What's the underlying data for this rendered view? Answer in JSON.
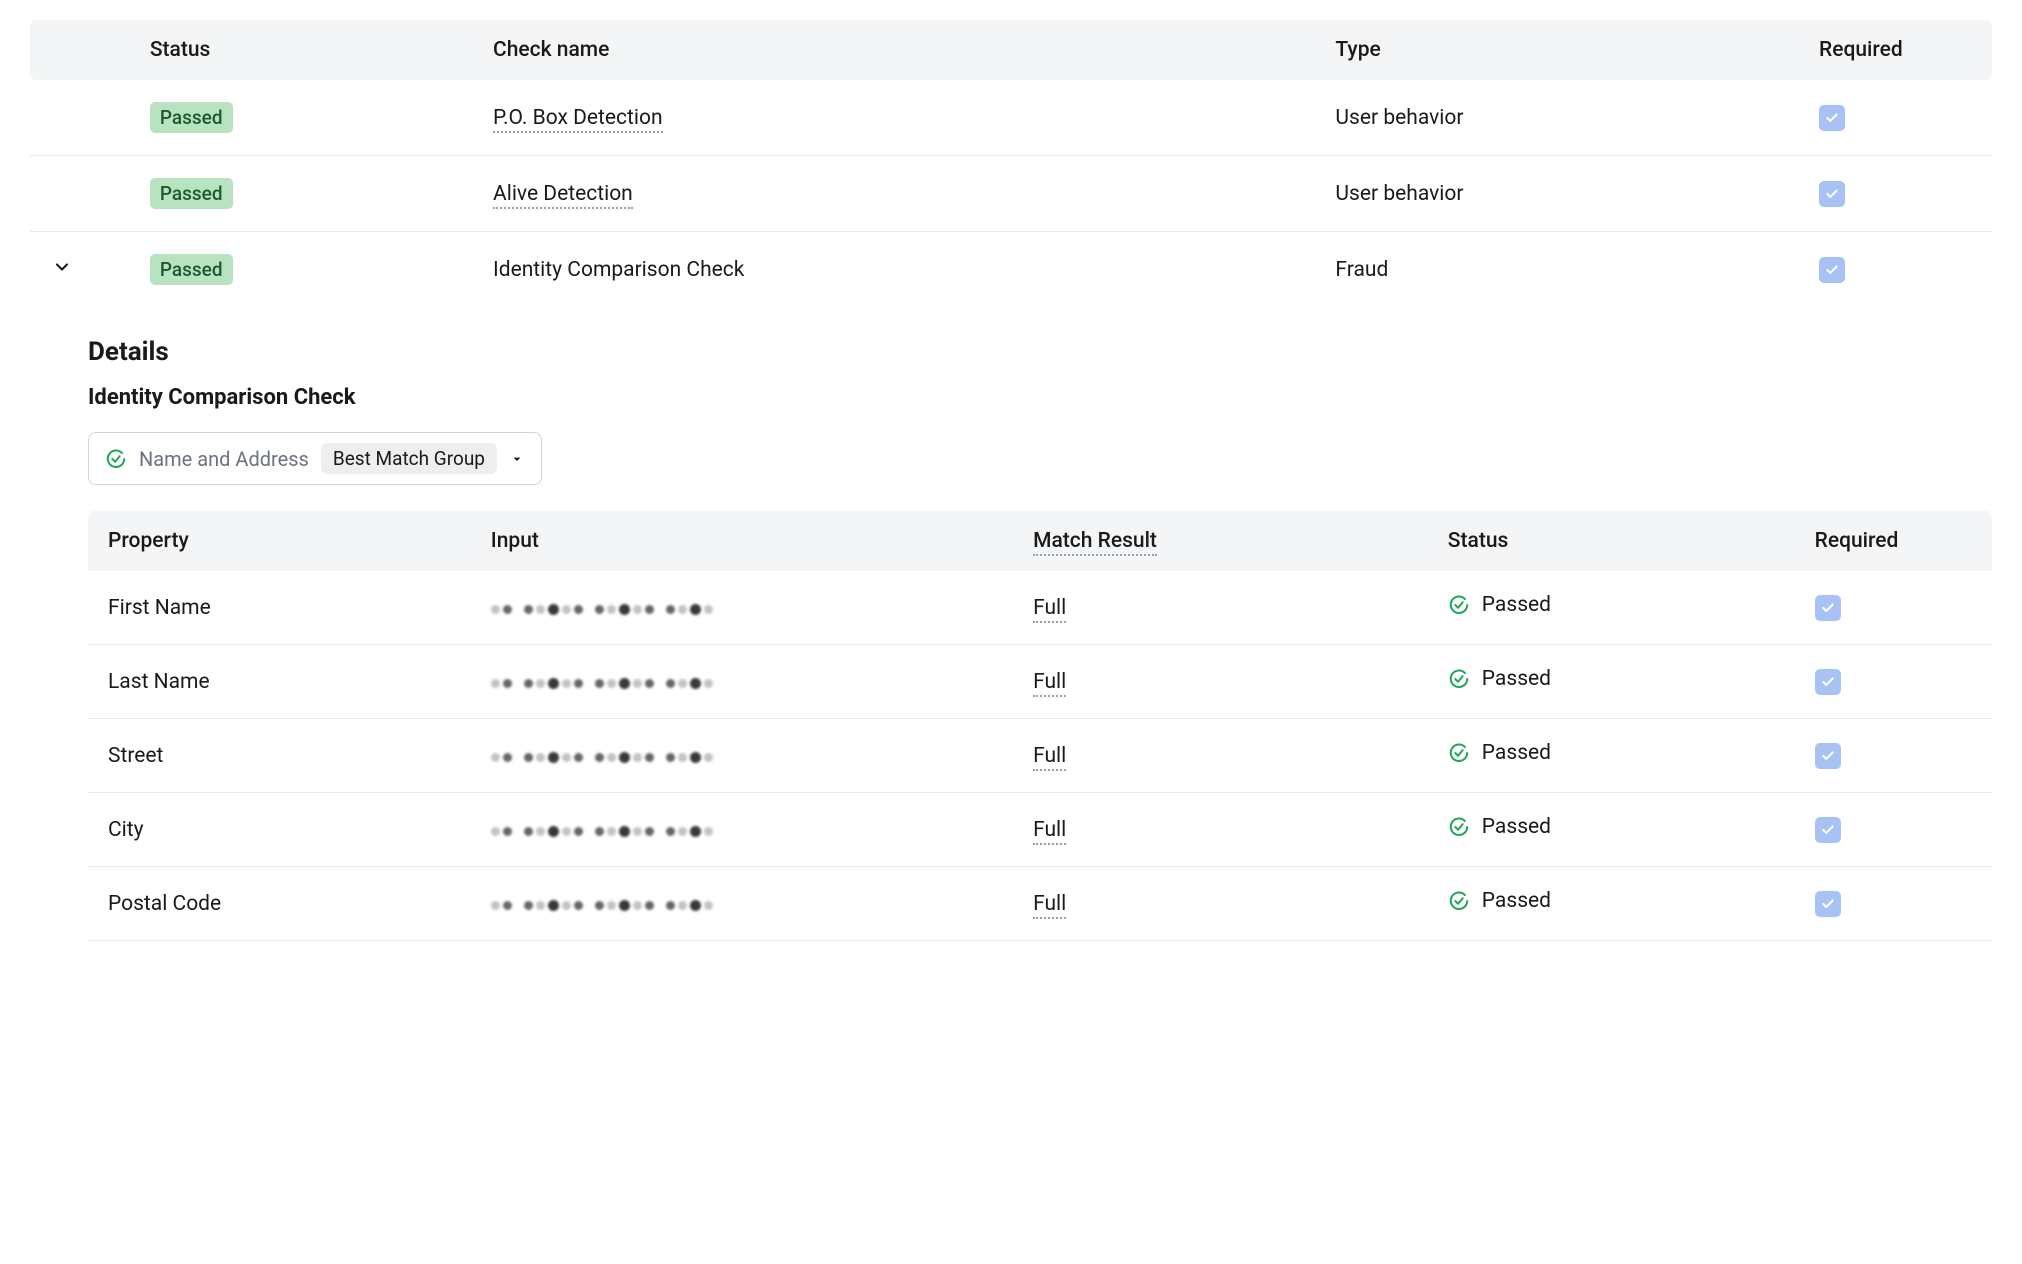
{
  "main": {
    "headers": {
      "status": "Status",
      "check_name": "Check name",
      "type": "Type",
      "required": "Required"
    },
    "rows": [
      {
        "status": "Passed",
        "name": "P.O. Box Detection",
        "name_dotted": true,
        "type": "User behavior",
        "required": true,
        "expanded": false
      },
      {
        "status": "Passed",
        "name": "Alive Detection",
        "name_dotted": true,
        "type": "User behavior",
        "required": true,
        "expanded": false
      },
      {
        "status": "Passed",
        "name": "Identity Comparison Check",
        "name_dotted": false,
        "type": "Fraud",
        "required": true,
        "expanded": true
      }
    ]
  },
  "details": {
    "title": "Details",
    "subtitle": "Identity Comparison Check",
    "selector": {
      "label": "Name and Address",
      "group": "Best Match Group"
    },
    "headers": {
      "property": "Property",
      "input": "Input",
      "match_result": "Match Result",
      "status": "Status",
      "required": "Required"
    },
    "rows": [
      {
        "property": "First Name",
        "match": "Full",
        "status": "Passed",
        "required": true
      },
      {
        "property": "Last Name",
        "match": "Full",
        "status": "Passed",
        "required": true
      },
      {
        "property": "Street",
        "match": "Full",
        "status": "Passed",
        "required": true
      },
      {
        "property": "City",
        "match": "Full",
        "status": "Passed",
        "required": true
      },
      {
        "property": "Postal Code",
        "match": "Full",
        "status": "Passed",
        "required": true
      }
    ]
  }
}
